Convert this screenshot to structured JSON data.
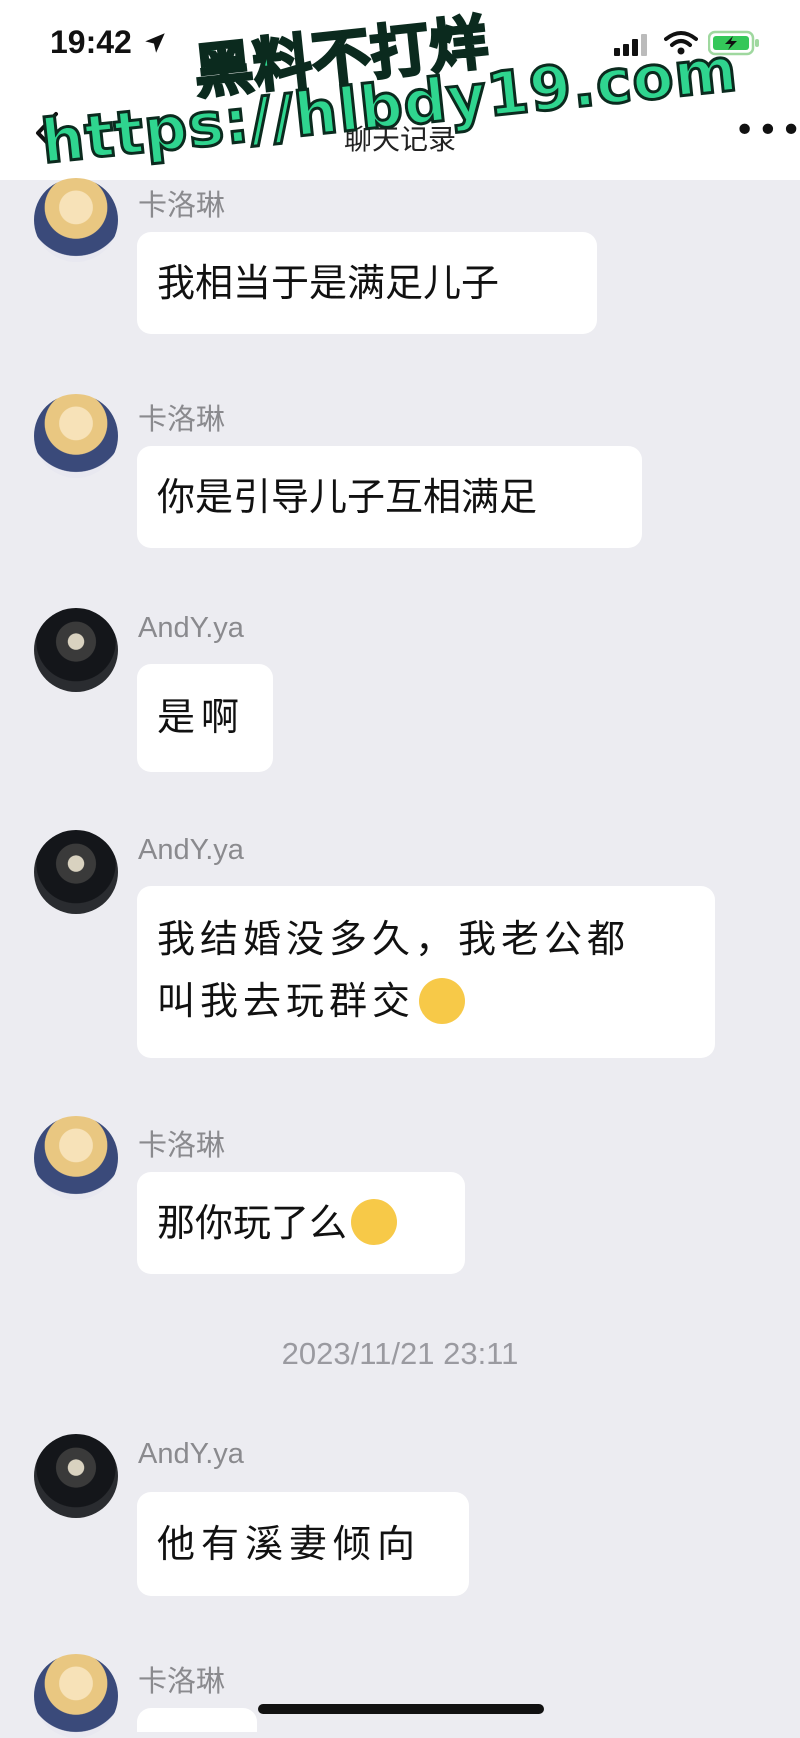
{
  "status_bar": {
    "time": "19:42"
  },
  "nav": {
    "title": "聊天记录"
  },
  "watermark": {
    "line1": "黑料不打烊",
    "line2": "https://hlbdy19.com"
  },
  "messages": [
    {
      "sender": "卡洛琳",
      "text": "我相当于是满足儿子"
    },
    {
      "sender": "卡洛琳",
      "text": "你是引导儿子互相满足"
    },
    {
      "sender": "AndY.ya",
      "text": "是啊"
    },
    {
      "sender": "AndY.ya",
      "text": "我结婚没多久，我老公都\n叫我去玩群交"
    },
    {
      "sender": "卡洛琳",
      "text": "那你玩了么"
    },
    {
      "sender": "AndY.ya",
      "text": "他有溪妻倾向"
    },
    {
      "sender": "卡洛琳",
      "text": ""
    }
  ],
  "timestamp": "2023/11/21 23:11",
  "colors": {
    "background": "#ececf1",
    "bubble": "#ffffff",
    "watermark": "#2fd58f"
  }
}
